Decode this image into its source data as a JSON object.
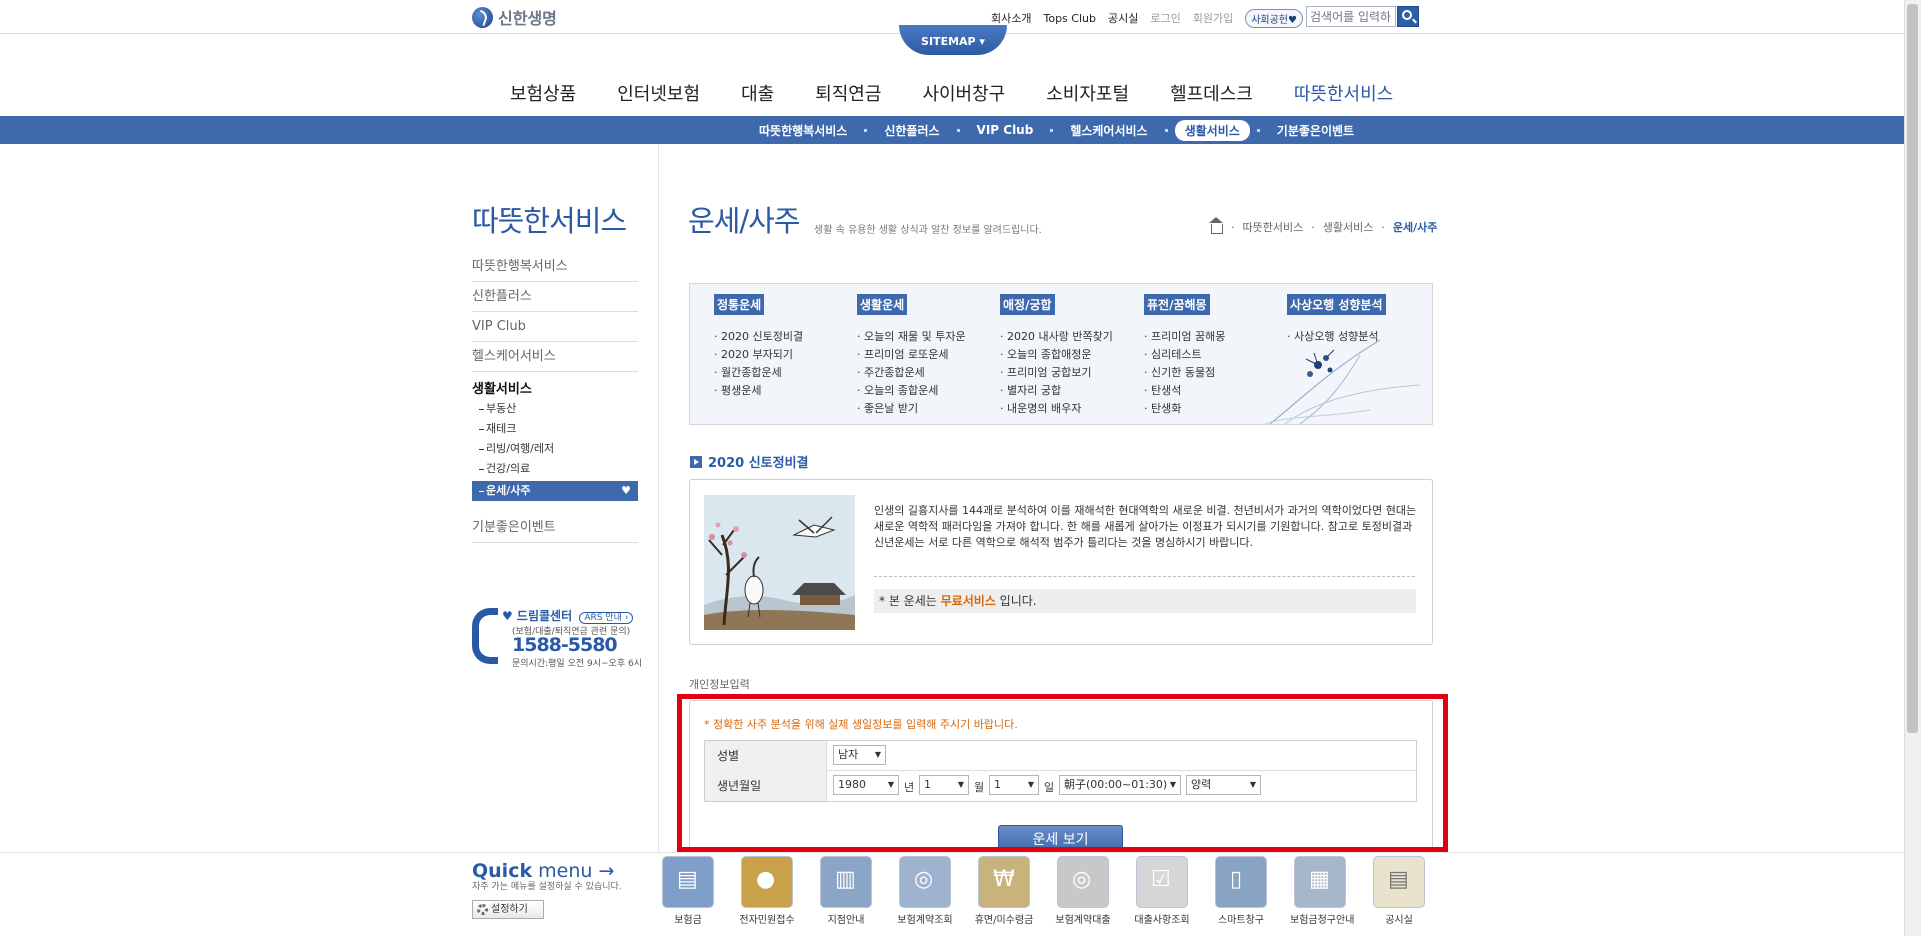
{
  "header": {
    "logo_text": "신한생명",
    "util_links": [
      "회사소개",
      "Tops Club",
      "공시실",
      "로그인",
      "회원가입"
    ],
    "util_pill": "사회공헌♥",
    "search_placeholder": "검색어를 입력하세요",
    "sitemap_label": "SITEMAP ▾"
  },
  "gnb": [
    "보험상품",
    "인터넷보험",
    "대출",
    "퇴직연금",
    "사이버창구",
    "소비자포털",
    "헬프데스크",
    "따뜻한서비스"
  ],
  "subnav": [
    "따뜻한행복서비스",
    "신한플러스",
    "VIP Club",
    "헬스케어서비스",
    "생활서비스",
    "기분좋은이벤트"
  ],
  "left": {
    "title": "따뜻한서비스",
    "items": [
      "따뜻한행복서비스",
      "신한플러스",
      "VIP Club",
      "헬스케어서비스"
    ],
    "current": "생활서비스",
    "subitems": [
      "부동산",
      "재테크",
      "리빙/여행/레저",
      "건강/의료"
    ],
    "active_sub": "운세/사주",
    "last": "기분좋은이벤트",
    "call": {
      "title": "♥ 드림콜센터",
      "ars": "ARS 안내 ›",
      "desc": "(보험/대출/퇴직연금 관련 문의)",
      "number": "1588-5580",
      "hours": "문의시간:평일 오전 9시~오후 6시"
    }
  },
  "main": {
    "title": "운세/사주",
    "desc": "생활 속 유용한 생활 상식과 알찬 정보를 알려드립니다.",
    "breadcrumb": [
      "따뜻한서비스",
      "생활서비스",
      "운세/사주"
    ],
    "categories": [
      {
        "head": "정통운세",
        "items": [
          "2020 신토정비결",
          "2020 부자되기",
          "월간종합운세",
          "평생운세"
        ]
      },
      {
        "head": "생활운세",
        "items": [
          "오늘의 재물 및 투자운",
          "프리미엄 로또운세",
          "주간종합운세",
          "오늘의 종합운세",
          "좋은날 받기"
        ]
      },
      {
        "head": "애정/궁합",
        "items": [
          "2020 내사랑 반쪽찾기",
          "오늘의 종합애정운",
          "프리미엄 궁합보기",
          "별자리 궁합",
          "내운명의 배우자"
        ]
      },
      {
        "head": "퓨전/꿈해몽",
        "items": [
          "프리미엄 꿈해몽",
          "심리테스트",
          "신기한 동물점",
          "탄생석",
          "탄생화"
        ]
      },
      {
        "head": "사상오행 성향분석",
        "items": [
          "사상오행 성향분석"
        ]
      }
    ],
    "section_title": "2020 신토정비결",
    "intro": "인생의 길흉지사를 144괘로 분석하여 이를 재해석한 현대역학의 새로운 비결. 천년비서가 과거의 역학이었다면 현대는 새로운 역학적 패러다임을 가져야 합니다. 한 해를 새롭게 살아가는 이정표가 되시기를 기원합니다. 참고로 토정비결과 신년운세는 서로 다른 역학으로 해석적 범주가 틀리다는 것을 명심하시기 바랍니다.",
    "free_prefix": "* 본 운세는",
    "free_word": "무료서비스",
    "free_suffix": "입니다.",
    "input_label": "개인정보입력",
    "notice": "* 정확한 사주 분석을 위해 실제 생일정보를 입력해 주시기 바랍니다.",
    "form": {
      "gender_label": "성별",
      "gender_value": "남자",
      "birth_label": "생년월일",
      "year": "1980",
      "year_unit": "년",
      "month": "1",
      "month_unit": "월",
      "day": "1",
      "day_unit": "일",
      "hour": "朝子(00:00~01:30)",
      "calendar": "양력"
    },
    "submit": "운세 보기"
  },
  "quick": {
    "title_bold": "Quick",
    "title_rest": "menu",
    "subtitle": "자주 가는 메뉴를 설정하실 수 있습니다.",
    "setting": "설정하기",
    "items": [
      {
        "label": "보험금",
        "color": "#7f9ec9",
        "icon": "document-icon"
      },
      {
        "label": "전자민원접수",
        "color": "#c9a14a",
        "icon": "chat-icon"
      },
      {
        "label": "지점안내",
        "color": "#8aa5c6",
        "icon": "building-icon"
      },
      {
        "label": "보험계약조회",
        "color": "#9fb3cf",
        "icon": "search-doc-icon"
      },
      {
        "label": "휴면/미수령금",
        "color": "#c9b37d",
        "icon": "coins-icon"
      },
      {
        "label": "보험계약대출",
        "color": "#c8c8c8",
        "icon": "insurance-icon"
      },
      {
        "label": "대출사항조회",
        "color": "#d6d6d6",
        "icon": "loan-icon"
      },
      {
        "label": "스마트창구",
        "color": "#88a3c4",
        "icon": "smartphone-icon"
      },
      {
        "label": "보험금청구안내",
        "color": "#a7b7c9",
        "icon": "calculator-icon"
      },
      {
        "label": "공시실",
        "color": "#e9e2cc",
        "icon": "public-doc-icon"
      }
    ]
  }
}
